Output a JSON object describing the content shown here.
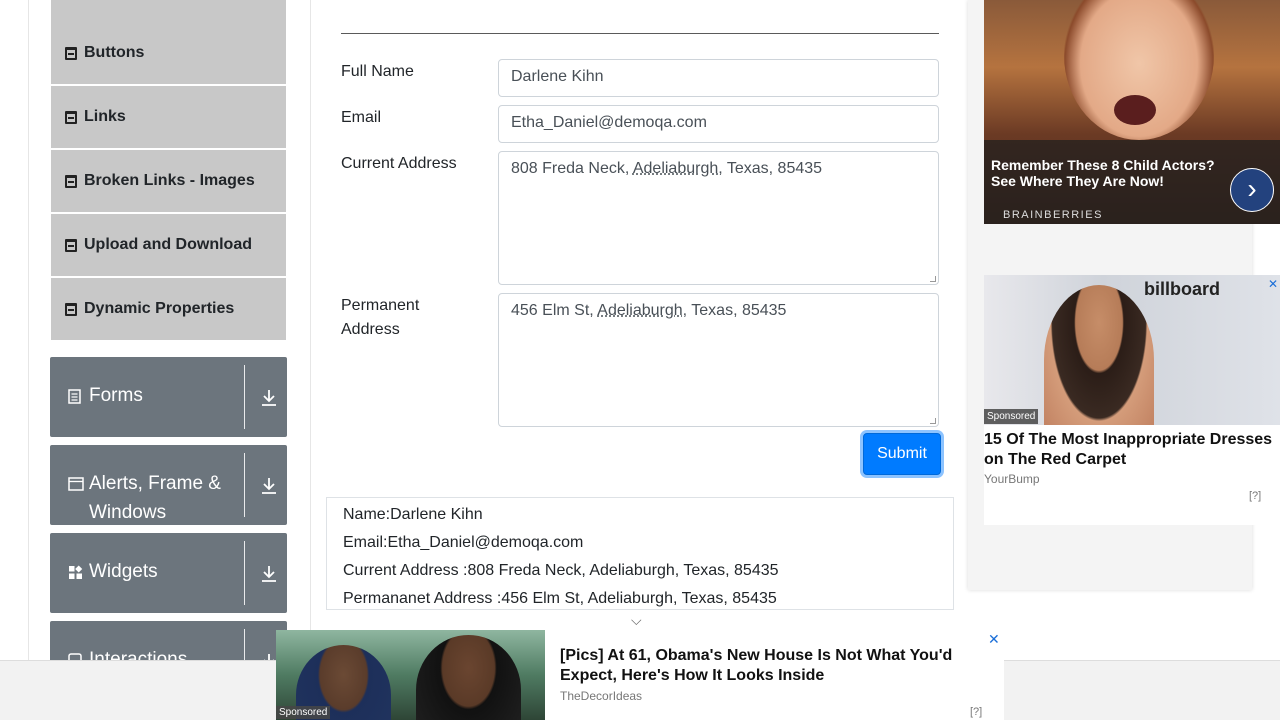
{
  "sidebar": {
    "elements_items": [
      {
        "label": "Buttons"
      },
      {
        "label": "Links"
      },
      {
        "label": "Broken Links - Images"
      },
      {
        "label": "Upload and Download"
      },
      {
        "label": "Dynamic Properties"
      }
    ],
    "groups": [
      {
        "label": "Forms",
        "icon": "document-icon"
      },
      {
        "label": "Alerts, Frame & Windows",
        "icon": "window-icon"
      },
      {
        "label": "Widgets",
        "icon": "widgets-icon"
      },
      {
        "label": "Interactions",
        "icon": "interactions-icon"
      }
    ],
    "colors": {
      "group_bg": "#6c757d",
      "item_bg": "#c8c8c8"
    }
  },
  "form": {
    "full_name_label": "Full Name",
    "full_name_value": "Darlene Kihn",
    "email_label": "Email",
    "email_value": "Etha_Daniel@demoqa.com",
    "current_address_label": "Current Address",
    "current_address_prefix": "808 Freda Neck, ",
    "current_address_city": "Adeliaburgh",
    "current_address_suffix": ", Texas, 85435",
    "permanent_address_label_1": "Permanent",
    "permanent_address_label_2": "Address",
    "permanent_address_prefix": "456 Elm St, ",
    "permanent_address_city": "Adeliaburgh",
    "permanent_address_suffix": ", Texas, 85435",
    "submit_label": "Submit",
    "accent": "#007bff"
  },
  "output": {
    "name": "Name:Darlene Kihn",
    "email": "Email:Etha_Daniel@demoqa.com",
    "current_address": "Current Address :808 Freda Neck, Adeliaburgh, Texas, 85435",
    "permanent_address": "Permananet Address :456 Elm St, Adeliaburgh, Texas, 85435"
  },
  "ads": {
    "top": {
      "title": "Remember These 8 Child Actors? See Where They Are Now!",
      "brand": "BRAINBERRIES",
      "arrow_icon": "chevron-right-icon"
    },
    "middle": {
      "banner_text": "billboard",
      "sponsored": "Sponsored",
      "headline": "15 Of The Most Inappropriate Dresses on The Red Carpet",
      "source": "YourBump",
      "tag": "[?]"
    },
    "bottom": {
      "sponsored": "Sponsored",
      "headline": "[Pics] At 61, Obama's New House Is Not What You'd Expect, Here's How It Looks Inside",
      "source": "TheDecorIdeas",
      "tag": "[?]",
      "close": "✕"
    }
  }
}
